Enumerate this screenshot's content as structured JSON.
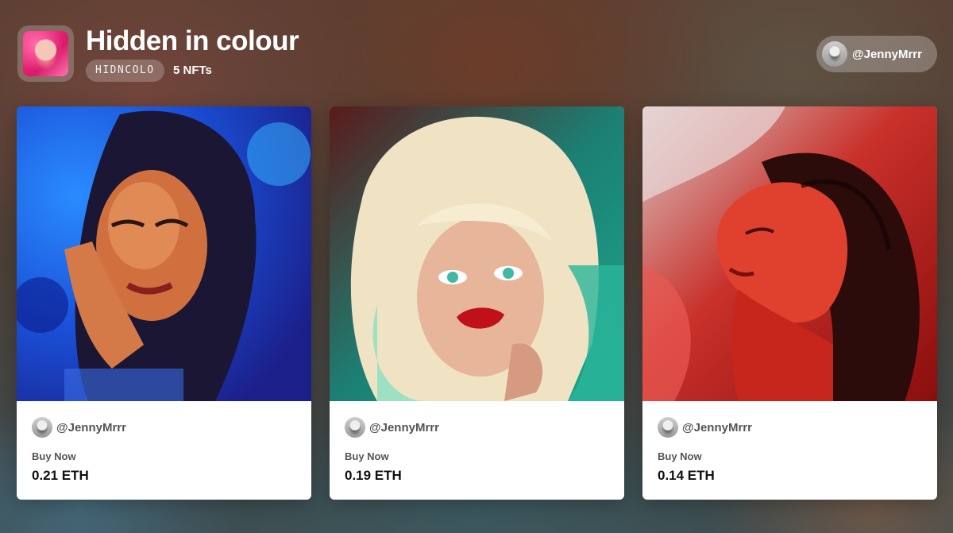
{
  "collection": {
    "title": "Hidden in colour",
    "symbol": "HIDNCOLO",
    "count": "5 NFTs"
  },
  "account": {
    "handle": "@JennyMrrr"
  },
  "cards": [
    {
      "creator": "@JennyMrrr",
      "buy_label": "Buy Now",
      "price": "0.21 ETH",
      "palette": "blue",
      "accent": "#1b6bff"
    },
    {
      "creator": "@JennyMrrr",
      "buy_label": "Buy Now",
      "price": "0.19 ETH",
      "palette": "teal-blonde",
      "accent": "#19a88f"
    },
    {
      "creator": "@JennyMrrr",
      "buy_label": "Buy Now",
      "price": "0.14 ETH",
      "palette": "red",
      "accent": "#e2231a"
    }
  ],
  "colors": {
    "card_bg": "#ffffff",
    "title": "#ffffff",
    "price": "#111111",
    "muted": "#555555"
  }
}
